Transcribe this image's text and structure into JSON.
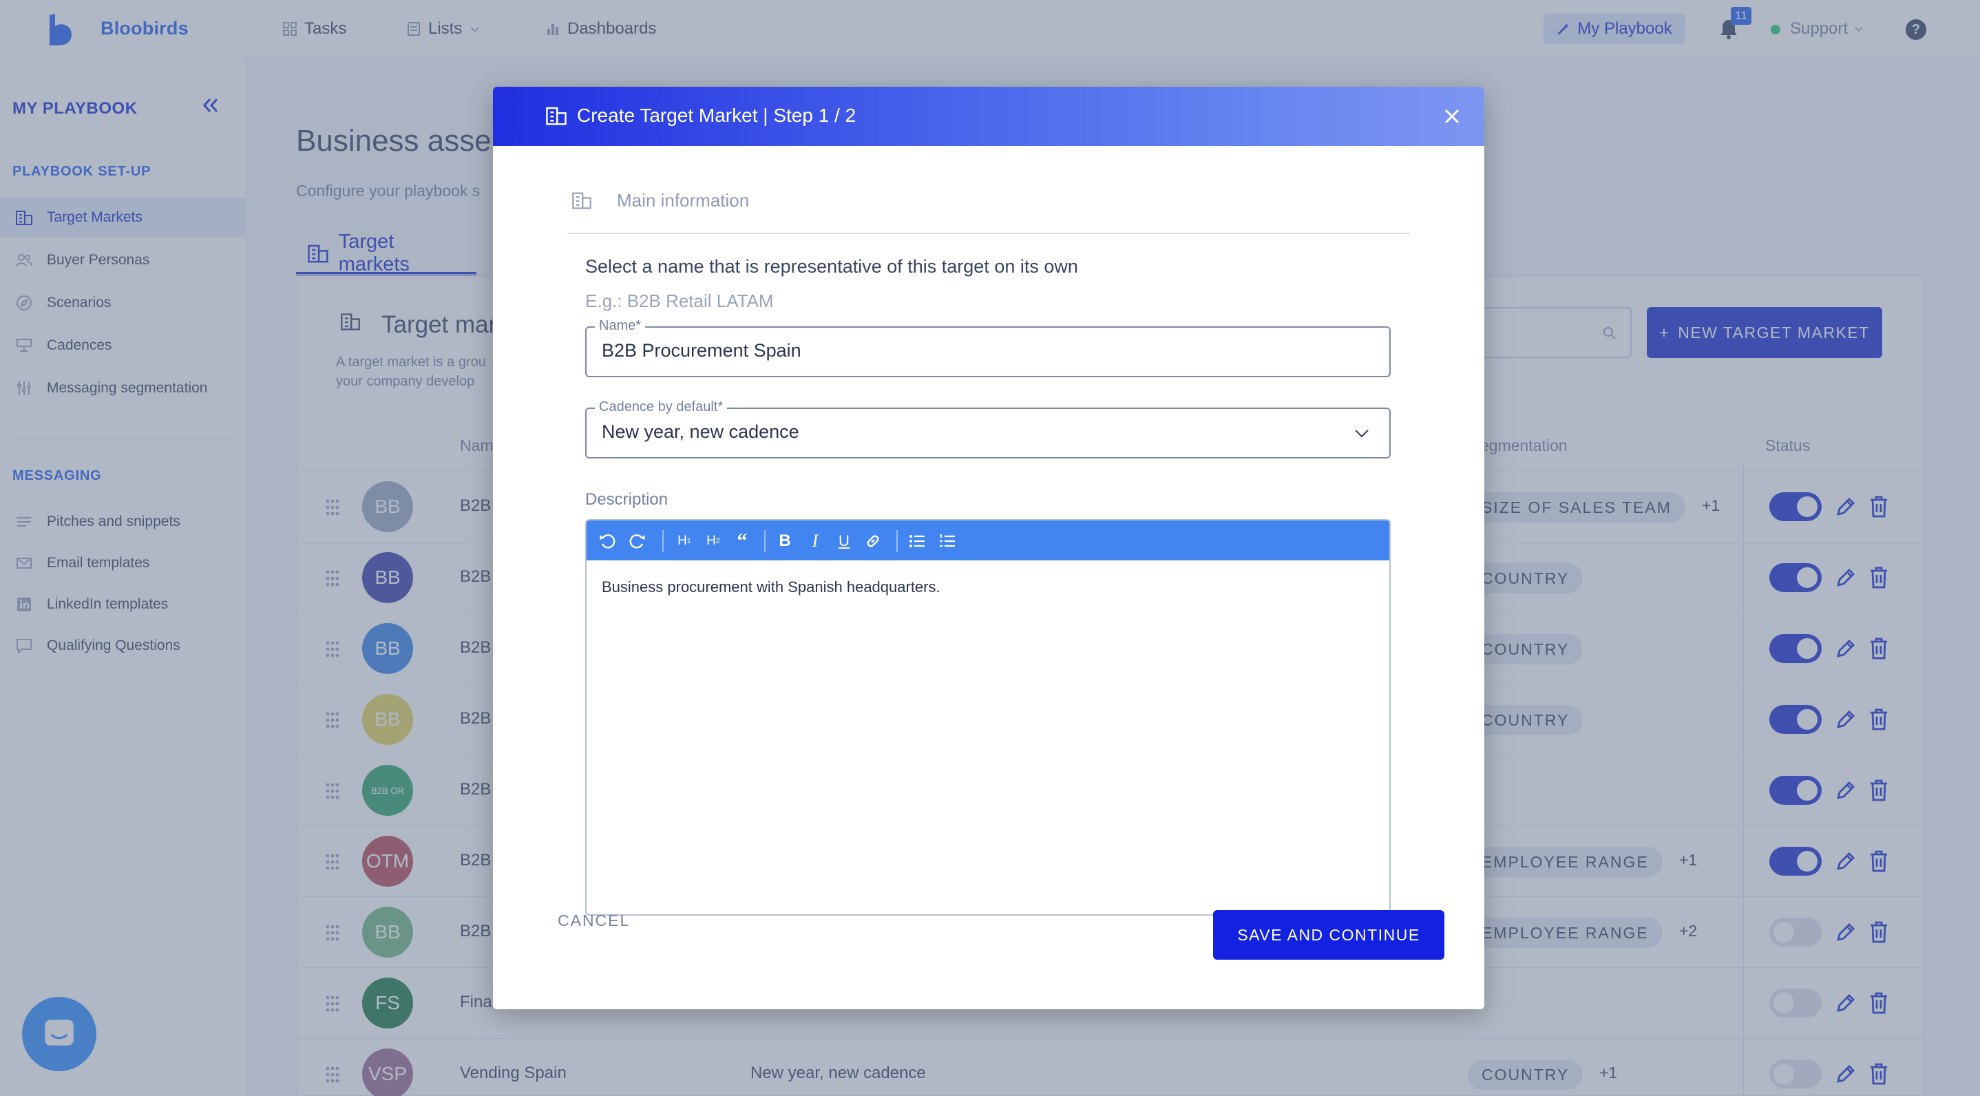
{
  "app": {
    "brand": "Bloobirds",
    "nav": [
      {
        "label": "Tasks",
        "icon": "grid-icon"
      },
      {
        "label": "Lists",
        "icon": "list-icon"
      },
      {
        "label": "Dashboards",
        "icon": "bar-chart-icon"
      }
    ],
    "my_playbook_label": "My Playbook",
    "notifications_count": "11",
    "support_label": "Support",
    "help_label": "?"
  },
  "sidebar": {
    "title": "MY PLAYBOOK",
    "setup_section": "PLAYBOOK SET-UP",
    "setup_items": [
      {
        "label": "Target Markets",
        "icon": "building-icon",
        "active": true
      },
      {
        "label": "Buyer Personas",
        "icon": "people-icon"
      },
      {
        "label": "Scenarios",
        "icon": "compass-icon"
      },
      {
        "label": "Cadences",
        "icon": "cadence-icon"
      },
      {
        "label": "Messaging segmentation",
        "icon": "segmentation-icon"
      }
    ],
    "messaging_section": "MESSAGING",
    "messaging_items": [
      {
        "label": "Pitches and snippets",
        "icon": "lines-icon"
      },
      {
        "label": "Email templates",
        "icon": "mail-icon"
      },
      {
        "label": "LinkedIn templates",
        "icon": "linkedin-icon"
      },
      {
        "label": "Qualifying Questions",
        "icon": "chat-icon"
      }
    ]
  },
  "main": {
    "title": "Business asse",
    "subtitle": "Configure your playbook s",
    "tab_label": "Target markets",
    "card_title": "Target mar",
    "card_desc_1": "A target market is a grou",
    "card_desc_2": "your company develop",
    "new_button": "NEW TARGET MARKET",
    "columns": {
      "name": "Nam",
      "segmentation": "egmentation",
      "status": "Status"
    },
    "rows": [
      {
        "avatar": "BB",
        "color": "#9aa6bf",
        "name": "B2B",
        "cadence": "",
        "seg": "SIZE OF SALES TEAM",
        "plus": "+1",
        "enabled": true
      },
      {
        "avatar": "BB",
        "color": "#3a3fa8",
        "name": "B2B",
        "cadence": "",
        "seg": "COUNTRY",
        "plus": "",
        "enabled": true
      },
      {
        "avatar": "BB",
        "color": "#3b82e8",
        "name": "B2B",
        "cadence": "",
        "seg": "COUNTRY",
        "plus": "",
        "enabled": true
      },
      {
        "avatar": "BB",
        "color": "#e3d35b",
        "name": "B2B",
        "cadence": "",
        "seg": "COUNTRY",
        "plus": "",
        "enabled": true
      },
      {
        "avatar": "B2B OR",
        "color": "#2ea56b",
        "name": "B2B",
        "cadence": "",
        "seg": "",
        "plus": "",
        "enabled": true
      },
      {
        "avatar": "OTM",
        "color": "#b94b59",
        "name": "B2B",
        "cadence": "",
        "seg": "EMPLOYEE RANGE",
        "plus": "+1",
        "enabled": true
      },
      {
        "avatar": "BB",
        "color": "#73b77f",
        "name": "B2B",
        "cadence": "",
        "seg": "EMPLOYEE RANGE",
        "plus": "+2",
        "enabled": false
      },
      {
        "avatar": "FS",
        "color": "#1f7a44",
        "name": "Fina",
        "cadence": "",
        "seg": "",
        "plus": "",
        "enabled": false
      },
      {
        "avatar": "VSP",
        "color": "#9c6b8e",
        "name": "Vending Spain",
        "cadence": "New year, new cadence",
        "seg": "COUNTRY",
        "plus": "+1",
        "enabled": false
      }
    ]
  },
  "modal": {
    "title": "Create Target Market | Step 1 / 2",
    "section_label": "Main information",
    "question": "Select a name that is representative of this target on its own",
    "hint": "E.g.: B2B Retail LATAM",
    "name_label": "Name*",
    "name_value": "B2B Procurement Spain",
    "cadence_label": "Cadence by default*",
    "cadence_value": "New year, new cadence",
    "description_label": "Description",
    "toolbar": [
      "undo-icon",
      "redo-icon",
      "h1-icon",
      "h2-icon",
      "quote-icon",
      "bold-icon",
      "italic-icon",
      "underline-icon",
      "link-icon",
      "bullet-list-icon",
      "numbered-list-icon"
    ],
    "description_text": "Business procurement with Spanish headquarters.",
    "cancel_label": "CANCEL",
    "save_label": "SAVE AND CONTINUE"
  },
  "colors": {
    "primary": "#1f2fd0",
    "accent": "#2760f0",
    "editor_toolbar": "#4385f0"
  }
}
